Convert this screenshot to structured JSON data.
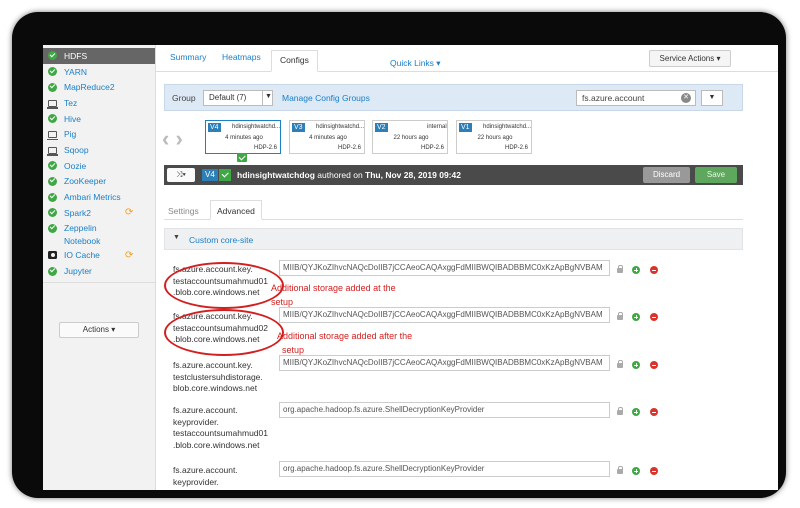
{
  "sidebar": {
    "items": [
      {
        "label": "HDFS",
        "icon": "check-circle-icon",
        "active": true
      },
      {
        "label": "YARN",
        "icon": "check-circle-icon"
      },
      {
        "label": "MapReduce2",
        "icon": "check-circle-icon"
      },
      {
        "label": "Tez",
        "icon": "laptop-icon"
      },
      {
        "label": "Hive",
        "icon": "check-circle-icon"
      },
      {
        "label": "Pig",
        "icon": "laptop-icon"
      },
      {
        "label": "Sqoop",
        "icon": "laptop-icon"
      },
      {
        "label": "Oozie",
        "icon": "check-circle-icon"
      },
      {
        "label": "ZooKeeper",
        "icon": "check-circle-icon"
      },
      {
        "label": "Ambari Metrics",
        "icon": "check-circle-icon"
      },
      {
        "label": "Spark2",
        "icon": "check-circle-icon",
        "refresh": true
      },
      {
        "label": "Zeppelin",
        "label2": "Notebook",
        "icon": "check-circle-icon"
      },
      {
        "label": "IO Cache",
        "icon": "camera-icon",
        "refresh": true
      },
      {
        "label": "Jupyter",
        "icon": "check-circle-icon"
      }
    ],
    "actions_label": "Actions ▾"
  },
  "tabs": [
    "Summary",
    "Heatmaps",
    "Configs"
  ],
  "quick_links": "Quick Links ▾",
  "service_actions": "Service Actions ▾",
  "groupbar": {
    "label": "Group",
    "group_value": "Default (7)",
    "manage_link": "Manage Config Groups",
    "search_value": "fs.azure.account"
  },
  "versions": [
    {
      "badge": "V4",
      "author": "hdinsightwatchd...",
      "time": "4 minutes ago",
      "hdp": "HDP-2.6",
      "current": true
    },
    {
      "badge": "V3",
      "author": "hdinsightwatchd...",
      "time": "4 minutes ago",
      "hdp": "HDP-2.6"
    },
    {
      "badge": "V2",
      "author": "internal",
      "time": "22 hours ago",
      "hdp": "HDP-2.6"
    },
    {
      "badge": "V1",
      "author": "hdinsightwatchd...",
      "time": "22 hours ago",
      "hdp": "HDP-2.6"
    }
  ],
  "current": {
    "badge": "V4",
    "author": "hdinsightwatchdog",
    "authored_on": "authored on",
    "date": "Thu, Nov 28, 2019 09:42",
    "discard": "Discard",
    "save": "Save"
  },
  "subtabs": [
    "Settings",
    "Advanced"
  ],
  "section_title": "Custom core-site",
  "properties": [
    {
      "lines": [
        "fs.azure.account.key.",
        "testaccountsumahmud01",
        ".blob.core.windows.net"
      ],
      "value": "MIIB/QYJKoZIhvcNAQcDoIIB7jCCAeoCAQAxggFdMIIBWQIBADBBMC0xKzApBgNVBAM"
    },
    {
      "lines": [
        "fs.azure.account.key.",
        "testaccountsumahmud02",
        ".blob.core.windows.net"
      ],
      "value": "MIIB/QYJKoZIhvcNAQcDoIIB7jCCAeoCAQAxggFdMIIBWQIBADBBMC0xKzApBgNVBAM"
    },
    {
      "lines": [
        "fs.azure.account.key.",
        "testclustersuhdistorage.",
        "blob.core.windows.net"
      ],
      "value": "MIIB/QYJKoZIhvcNAQcDoIIB7jCCAeoCAQAxggFdMIIBWQIBADBBMC0xKzApBgNVBAM"
    },
    {
      "lines": [
        "fs.azure.account.",
        "keyprovider.",
        "testaccountsumahmud01",
        ".blob.core.windows.net"
      ],
      "value": "org.apache.hadoop.fs.azure.ShellDecryptionKeyProvider"
    },
    {
      "lines": [
        "fs.azure.account.",
        "keyprovider."
      ],
      "value": "org.apache.hadoop.fs.azure.ShellDecryptionKeyProvider"
    }
  ],
  "annotations": [
    {
      "line1": "Additional storage added at the",
      "line2": "setup"
    },
    {
      "line1": "Additional storage added after the",
      "line2": "setup"
    }
  ],
  "colors": {
    "link": "#1a80c8",
    "annotation": "#d21f1f",
    "save_green": "#5da85d",
    "active_sidebar": "#666666"
  }
}
